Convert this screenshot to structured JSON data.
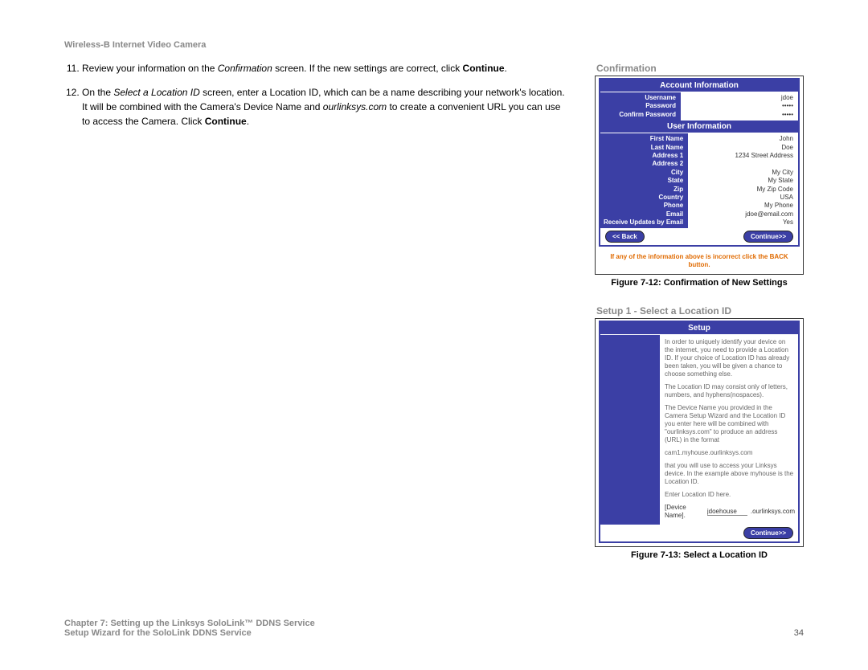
{
  "header": {
    "product": "Wireless-B Internet Video Camera"
  },
  "steps": {
    "start": 11,
    "item11": {
      "pre": "Review your information on the ",
      "italic1": "Confirmation",
      "mid": " screen. If the new settings are correct, click ",
      "bold1": "Continue",
      "post": "."
    },
    "item12": {
      "pre": "On the ",
      "italic1": "Select a Location ID",
      "mid": " screen, enter a Location ID, which can be a name describing your network's location. It will be combined with the Camera's Device Name and ",
      "italic2": "ourlinksys.com",
      "mid2": " to create a convenient URL you can use to access the Camera. Click ",
      "bold1": "Continue",
      "post": "."
    }
  },
  "fig1": {
    "outside_title": "Confirmation",
    "bar_account": "Account Information",
    "account_labels": {
      "u": "Username",
      "p": "Password",
      "cp": "Confirm Password"
    },
    "account_values": {
      "u": "jdoe",
      "p": "•••••",
      "cp": "•••••"
    },
    "bar_user": "User Information",
    "user_labels": {
      "fn": "First Name",
      "ln": "Last Name",
      "a1": "Address 1",
      "a2": "Address 2",
      "city": "City",
      "state": "State",
      "zip": "Zip",
      "country": "Country",
      "phone": "Phone",
      "email": "Email",
      "updates": "Receive Updates by Email"
    },
    "user_values": {
      "fn": "John",
      "ln": "Doe",
      "a1": "1234 Street Address",
      "a2": "",
      "city": "My City",
      "state": "My State",
      "zip": "My Zip Code",
      "country": "USA",
      "phone": "My Phone",
      "email": "jdoe@email.com",
      "updates": "Yes"
    },
    "back_btn": "<< Back",
    "continue_btn": "Continue>>",
    "warning": "If any of the information above is incorrect click the BACK button.",
    "caption": "Figure 7-12: Confirmation of New Settings"
  },
  "fig2": {
    "outside_title": "Setup 1 - Select a Location ID",
    "bar_setup": "Setup",
    "body": {
      "p1": "In order to uniquely identify your device on the internet, you need to provide a Location ID. If your choice of Location ID has already been taken, you will be given a chance to choose something else.",
      "p2": "The Location ID may consist only of letters, numbers, and hyphens(nospaces).",
      "p3": "The Device Name you provided in the Camera Setup Wizard and the Location ID you enter here will be combined with \"ourlinksys.com\" to produce an address (URL) in the format",
      "p4": "cam1.myhouse.ourlinksys.com",
      "p5": "that you will use to access your Linksys device. In the example above myhouse is the Location ID.",
      "p6": "Enter Location ID here.",
      "device_label": "[Device Name].",
      "device_value": "jdoehouse",
      "suffix": ".ourlinksys.com"
    },
    "continue_btn": "Continue>>",
    "caption": "Figure 7-13: Select a Location ID"
  },
  "footer": {
    "line1": "Chapter 7: Setting up the Linksys SoloLink™ DDNS Service",
    "line2": "Setup Wizard for the SoloLink DDNS Service",
    "page": "34"
  }
}
